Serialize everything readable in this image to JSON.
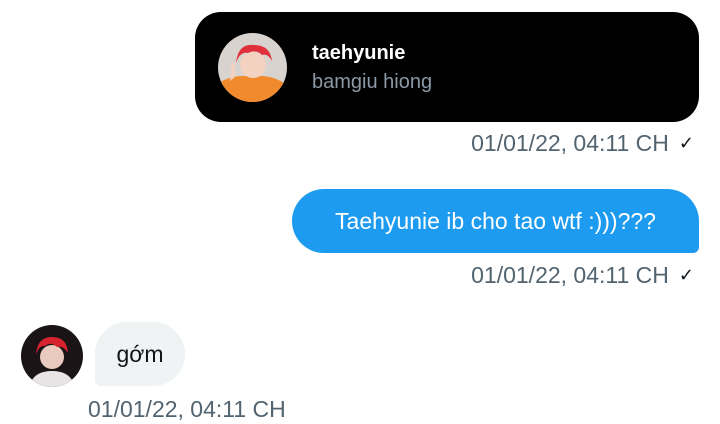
{
  "profile_card": {
    "name": "taehyunie",
    "handle": "bamgiu hiong",
    "avatar_icon": "avatar-red-hair-orange-shirt"
  },
  "messages": [
    {
      "direction": "outgoing",
      "type": "profile-share",
      "timestamp": "01/01/22, 04:11 CH",
      "status_icon": "check-icon"
    },
    {
      "direction": "outgoing",
      "text": "Taehyunie ib cho tao wtf :)))???",
      "timestamp": "01/01/22, 04:11 CH",
      "status_icon": "check-icon"
    },
    {
      "direction": "incoming",
      "text": "gớm",
      "timestamp": "01/01/22, 04:11 CH",
      "avatar_icon": "avatar-red-hair"
    }
  ],
  "colors": {
    "outgoing_bubble": "#1d9bf0",
    "incoming_bubble": "#eff3f4",
    "card_bg": "#000000",
    "timestamp": "#536471",
    "handle": "#8b98a5"
  }
}
